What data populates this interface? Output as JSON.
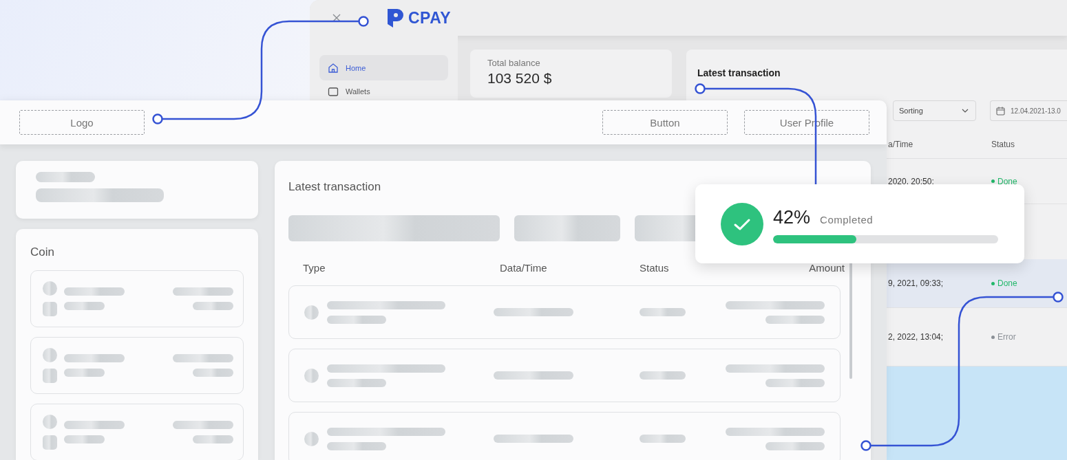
{
  "back_app": {
    "logo": "CPAY",
    "sidebar": {
      "items": [
        {
          "label": "Home",
          "selected": true
        },
        {
          "label": "Wallets",
          "selected": false
        }
      ]
    },
    "balance": {
      "label": "Total balance",
      "value": "103 520 $"
    },
    "transactions": {
      "title": "Latest transaction",
      "sorting": "Sorting",
      "date_range": "12.04.2021-13.0",
      "columns": [
        "a/Time",
        "Status"
      ],
      "rows": [
        {
          "date": "2020, 20:50;",
          "status": "Done",
          "color": "#22b86a",
          "selected": false
        },
        {
          "date": "9, 2021, 09:33;",
          "status": "Done",
          "color": "#22b86a",
          "selected": true
        },
        {
          "date": "2, 2022, 13:04;",
          "status": "Error",
          "color": "#8a8f96",
          "selected": false
        }
      ]
    }
  },
  "wireframe": {
    "header": {
      "logo": "Logo",
      "button": "Button",
      "profile": "User Profile"
    },
    "coin_card": {
      "title": "Coin"
    },
    "transactions": {
      "title": "Latest transaction",
      "columns": [
        "Type",
        "Data/Time",
        "Status",
        "Amount"
      ]
    }
  },
  "progress": {
    "percent": "42%",
    "label": "Completed",
    "level": 0.37
  }
}
